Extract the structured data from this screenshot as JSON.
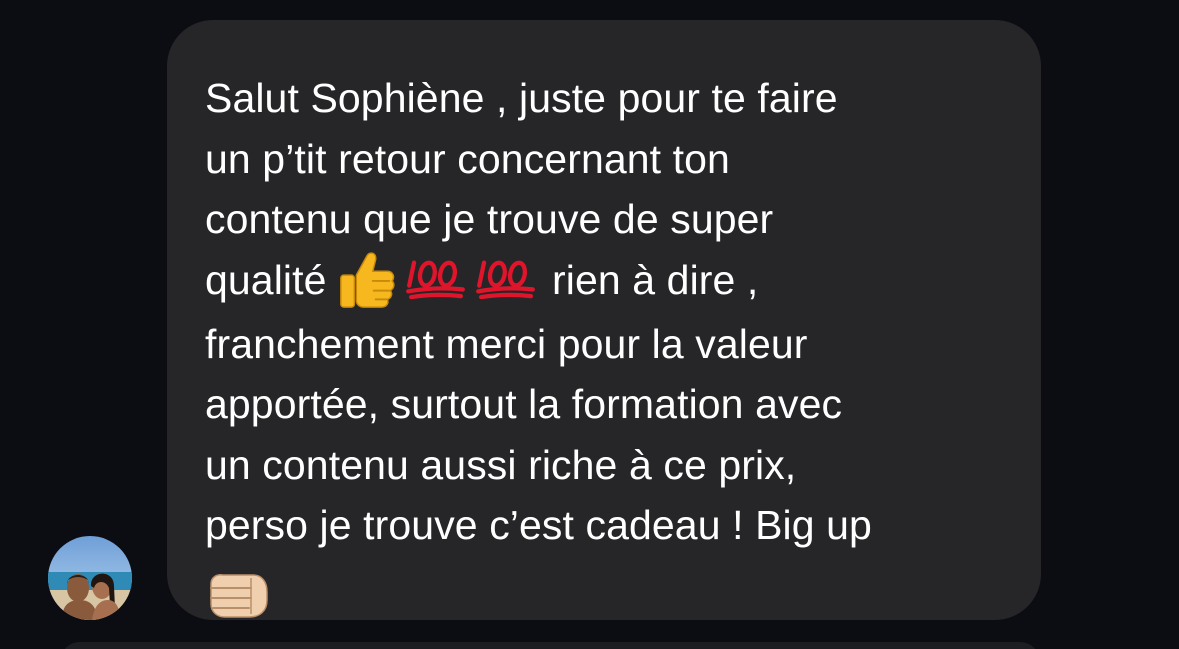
{
  "message": {
    "line1": "Salut Sophiène , juste pour te faire",
    "line2": "un p’tit retour concernant ton",
    "line3": "contenu que je trouve de super",
    "line4_before": "qualité",
    "line4_after": " rien à dire ,",
    "line5": "franchement merci pour la valeur",
    "line6": "apportée, surtout la formation avec",
    "line7": "un contenu aussi riche à ce prix,",
    "line8": "perso je trouve c’est cadeau ! Big up",
    "emojis": [
      "thumbs-up",
      "hundred-points",
      "hundred-points",
      "oncoming-fist-light-skin"
    ]
  },
  "colors": {
    "background": "#0b0d12",
    "bubble": "#262629",
    "text": "#ffffff",
    "emoji_hundred": "#e0152b",
    "emoji_thumb": "#f6b81e"
  }
}
